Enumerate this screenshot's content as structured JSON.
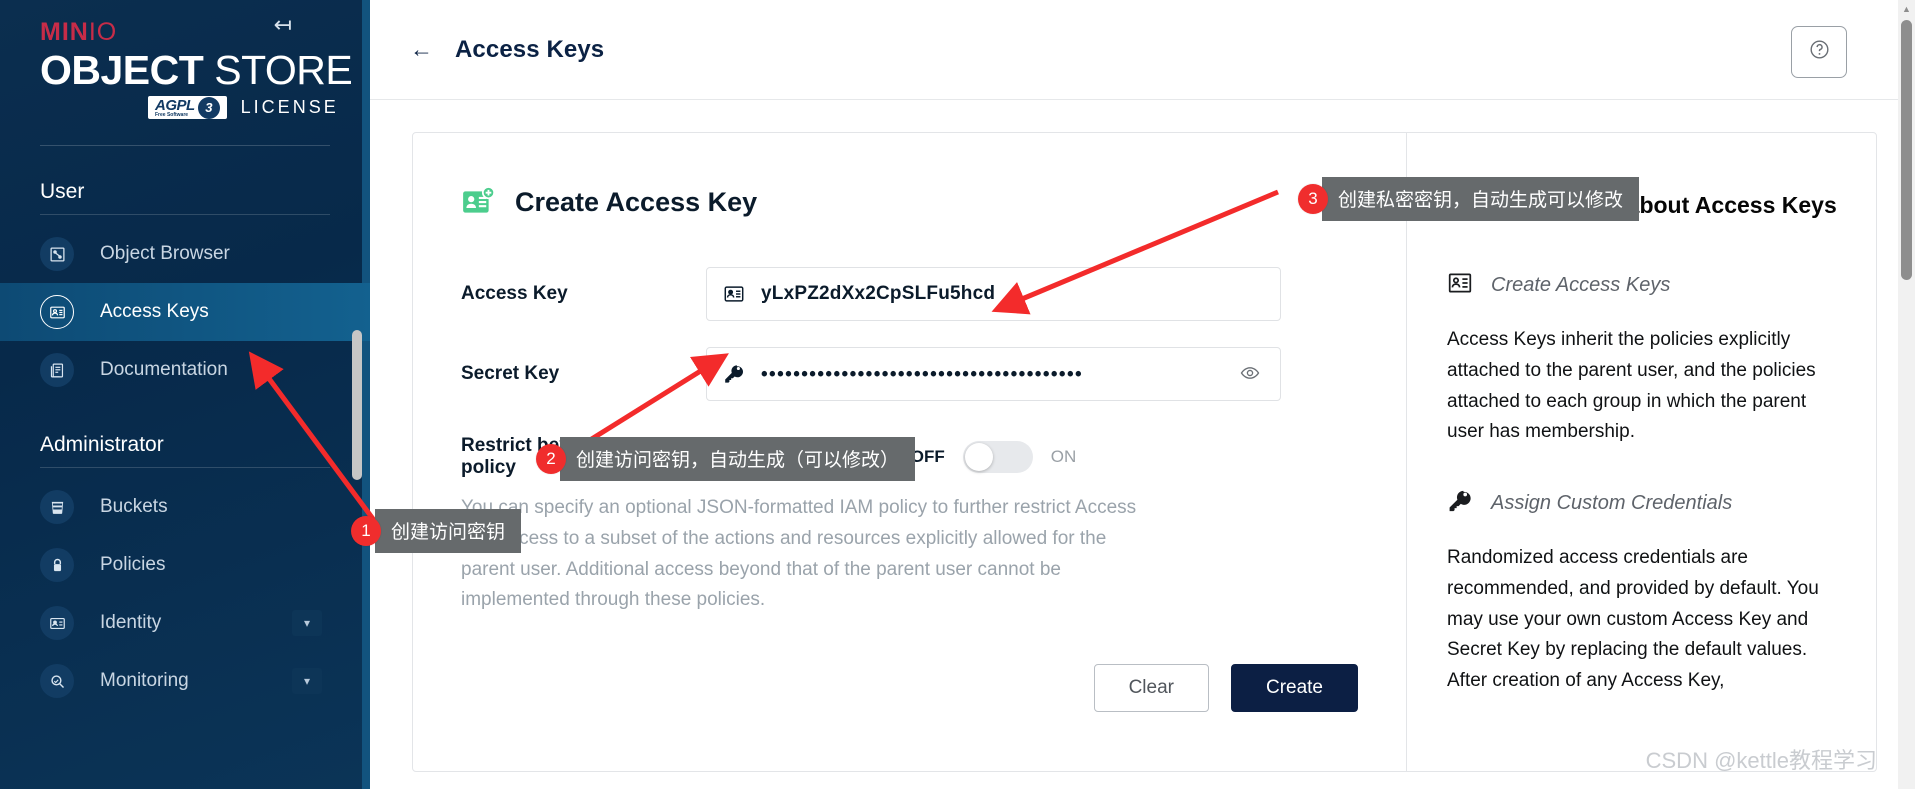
{
  "sidebar": {
    "brand": {
      "minio": "MIN",
      "minio_io": "IO",
      "object": "OBJECT",
      "store": "STORE",
      "agpl": "AGPL",
      "agpl_sub": "Free Software",
      "agpl_version": "3",
      "license": "LICENSE"
    },
    "collapse_icon": "collapse-panel-icon",
    "groups": [
      {
        "label": "User",
        "items": [
          {
            "label": "Object Browser",
            "icon": "object-browser-icon",
            "active": false,
            "chevron": false
          },
          {
            "label": "Access Keys",
            "icon": "access-keys-icon",
            "active": true,
            "chevron": false
          },
          {
            "label": "Documentation",
            "icon": "documentation-icon",
            "active": false,
            "chevron": false
          }
        ]
      },
      {
        "label": "Administrator",
        "items": [
          {
            "label": "Buckets",
            "icon": "bucket-icon",
            "active": false,
            "chevron": false
          },
          {
            "label": "Policies",
            "icon": "lock-icon",
            "active": false,
            "chevron": false
          },
          {
            "label": "Identity",
            "icon": "identity-card-icon",
            "active": false,
            "chevron": true
          },
          {
            "label": "Monitoring",
            "icon": "monitoring-search-icon",
            "active": false,
            "chevron": true
          }
        ]
      }
    ]
  },
  "topbar": {
    "back_icon": "back-arrow-icon",
    "title": "Access Keys",
    "help_icon": "help-circle-icon"
  },
  "form": {
    "title": "Create Access Key",
    "title_icon": "create-access-key-icon",
    "access_key": {
      "label": "Access Key",
      "value": "yLxPZ2dXx2CpSLFu5hcd",
      "icon": "access-key-card-icon"
    },
    "secret_key": {
      "label": "Secret Key",
      "value": "••••••••••••••••••••••••••••••••••••••••",
      "icon": "key-icon",
      "reveal_icon": "eye-icon"
    },
    "restrict": {
      "label": "Restrict beyond user policy",
      "off_label": "OFF",
      "on_label": "ON",
      "state": "OFF"
    },
    "description": "You can specify an optional JSON-formatted IAM policy to further restrict Access Key access to a subset of the actions and resources explicitly allowed for the parent user. Additional access beyond that of the parent user cannot be implemented through these policies.",
    "buttons": {
      "clear": "Clear",
      "create": "Create"
    }
  },
  "help": {
    "title": "Learn more about Access Keys",
    "title_icon": "help-filled-icon",
    "sections": [
      {
        "heading": "Create Access Keys",
        "icon": "access-key-card-icon",
        "body": "Access Keys inherit the policies explicitly attached to the parent user, and the policies attached to each group in which the parent user has membership."
      },
      {
        "heading": "Assign Custom Credentials",
        "icon": "key-icon",
        "body": "Randomized access credentials are recommended, and provided by default. You may use your own custom Access Key and Secret Key by replacing the default values. After creation of any Access Key,"
      }
    ]
  },
  "annotations": [
    {
      "number": "1",
      "text": "创建访问密钥"
    },
    {
      "number": "2",
      "text": "创建访问密钥，自动生成（可以修改）"
    },
    {
      "number": "3",
      "text": "创建私密密钥，自动生成可以修改"
    }
  ],
  "watermark": "CSDN @kettle教程学习",
  "colors": {
    "sidebar_bg": "#0b2e4f",
    "sidebar_active": "#13618f",
    "brand_red": "#c72c48",
    "accent_dark": "#0c1f44",
    "annotation_red": "#f02d2d",
    "annotation_gray": "#666a6c",
    "create_icon_green": "#4ccd8d"
  }
}
